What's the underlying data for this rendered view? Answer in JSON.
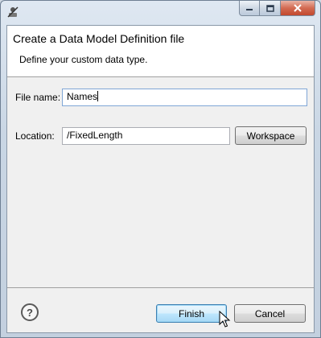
{
  "window": {
    "app_icon": "wizard-app-icon",
    "controls": {
      "minimize": "minimize-icon",
      "maximize": "maximize-icon",
      "close": "close-icon"
    }
  },
  "banner": {
    "title": "Create a Data Model Definition file",
    "description": "Define your custom data type."
  },
  "form": {
    "file_name_label": "File name:",
    "file_name_value": "Names",
    "location_label": "Location:",
    "location_value": "/FixedLength",
    "workspace_button": "Workspace"
  },
  "footer": {
    "help_icon": "help-icon",
    "help_glyph": "?",
    "finish_button": "Finish",
    "cancel_button": "Cancel"
  },
  "colors": {
    "default_button_border": "#3c7fb1",
    "close_button": "#c2482e",
    "dialog_bg": "#f0f0f0"
  }
}
